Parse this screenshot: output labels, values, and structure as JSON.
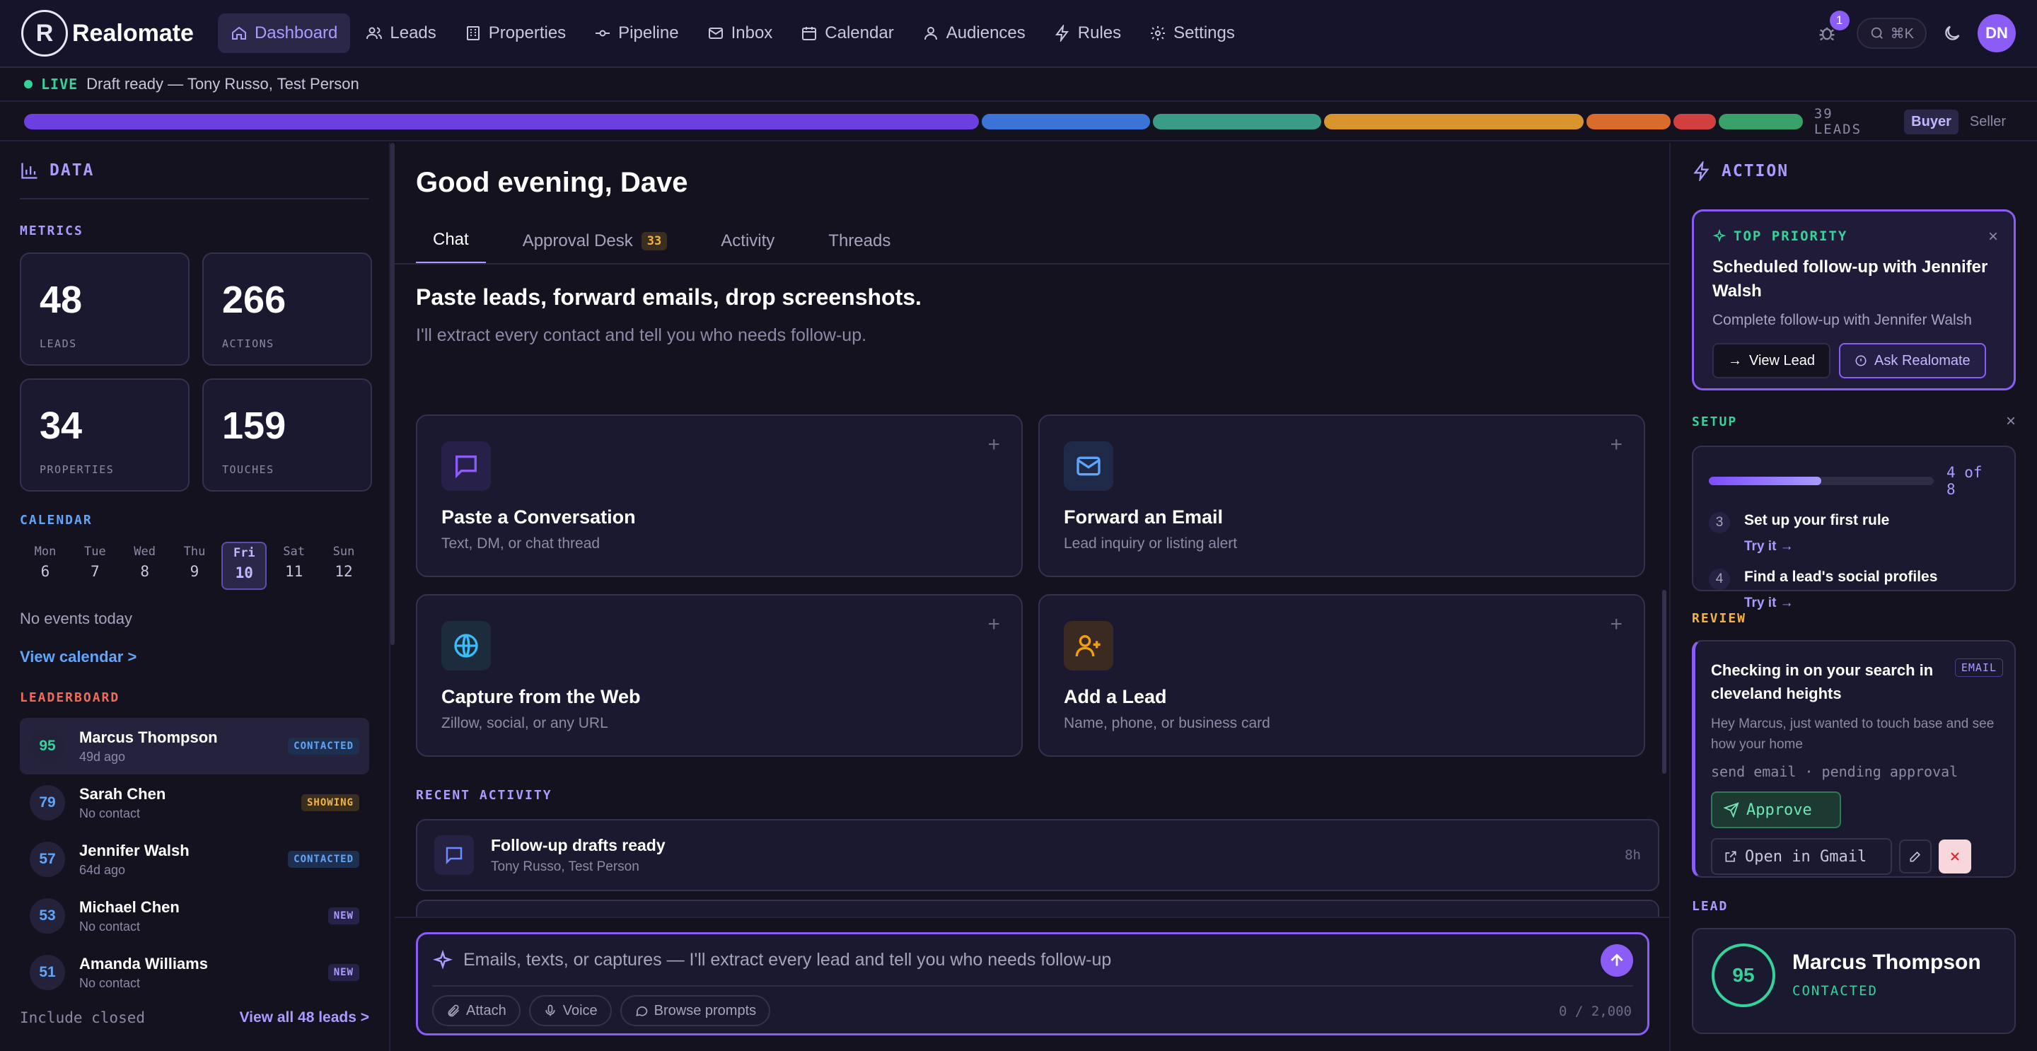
{
  "nav": {
    "brand": "Realomate",
    "brand_initial": "R",
    "items": [
      {
        "label": "Dashboard",
        "icon": "home-icon",
        "active": true
      },
      {
        "label": "Leads",
        "icon": "users-icon"
      },
      {
        "label": "Properties",
        "icon": "building-icon"
      },
      {
        "label": "Pipeline",
        "icon": "commit-icon"
      },
      {
        "label": "Inbox",
        "icon": "mail-icon"
      },
      {
        "label": "Calendar",
        "icon": "calendar-icon"
      },
      {
        "label": "Audiences",
        "icon": "user-circle-icon"
      },
      {
        "label": "Rules",
        "icon": "lightning-icon"
      },
      {
        "label": "Settings",
        "icon": "gear-icon"
      }
    ],
    "bug_count": "1",
    "search_shortcut": "⌘K",
    "avatar_initials": "DN"
  },
  "live": {
    "label": "LIVE",
    "text": "Draft ready — Tony Russo, Test Person"
  },
  "pipeline": {
    "segments": [
      {
        "share": 13.6,
        "color": "#6d3ee0"
      },
      {
        "share": 2.4,
        "color": "#3b74d6"
      },
      {
        "share": 2.4,
        "color": "#3a9c87"
      },
      {
        "share": 3.7,
        "color": "#d8952d"
      },
      {
        "share": 1.2,
        "color": "#d96c2c"
      },
      {
        "share": 0.6,
        "color": "#d13f3f"
      },
      {
        "share": 1.2,
        "color": "#3aa06a"
      }
    ],
    "leads_label": "39 LEADS",
    "toggle": [
      "Buyer",
      "Seller"
    ],
    "toggle_active": "Buyer"
  },
  "left": {
    "header": "DATA",
    "metrics_label": "METRICS",
    "metrics": [
      {
        "value": "48",
        "label": "LEADS"
      },
      {
        "value": "266",
        "label": "ACTIONS"
      },
      {
        "value": "34",
        "label": "PROPERTIES"
      },
      {
        "value": "159",
        "label": "TOUCHES"
      }
    ],
    "calendar_label": "CALENDAR",
    "days": [
      {
        "name": "Mon",
        "date": "6"
      },
      {
        "name": "Tue",
        "date": "7"
      },
      {
        "name": "Wed",
        "date": "8"
      },
      {
        "name": "Thu",
        "date": "9"
      },
      {
        "name": "Fri",
        "date": "10",
        "today": true
      },
      {
        "name": "Sat",
        "date": "11"
      },
      {
        "name": "Sun",
        "date": "12"
      }
    ],
    "no_events": "No events today",
    "view_calendar": "View calendar >",
    "leaderboard_label": "LEADERBOARD",
    "leaders": [
      {
        "score": "95",
        "name": "Marcus Thompson",
        "sub": "49d ago",
        "tag": "CONTACTED",
        "score_color": "#34d399",
        "tag_color": "#60a5fa",
        "tag_bg": "#1e2f4f"
      },
      {
        "score": "79",
        "name": "Sarah Chen",
        "sub": "No contact",
        "tag": "SHOWING",
        "score_color": "#60a5fa",
        "tag_color": "#f5b342",
        "tag_bg": "#3a2f1e"
      },
      {
        "score": "57",
        "name": "Jennifer Walsh",
        "sub": "64d ago",
        "tag": "CONTACTED",
        "score_color": "#60a5fa",
        "tag_color": "#60a5fa",
        "tag_bg": "#1e2f4f"
      },
      {
        "score": "53",
        "name": "Michael Chen",
        "sub": "No contact",
        "tag": "NEW",
        "score_color": "#60a5fa",
        "tag_color": "#a99cff",
        "tag_bg": "#26224a"
      },
      {
        "score": "51",
        "name": "Amanda Williams",
        "sub": "No contact",
        "tag": "NEW",
        "score_color": "#60a5fa",
        "tag_color": "#a99cff",
        "tag_bg": "#26224a"
      }
    ],
    "include_closed": "Include closed",
    "view_all": "View all 48 leads >"
  },
  "center": {
    "greeting": "Good evening, Dave",
    "tabs": [
      {
        "label": "Chat",
        "active": true
      },
      {
        "label": "Approval Desk",
        "count": "33"
      },
      {
        "label": "Activity"
      },
      {
        "label": "Threads"
      }
    ],
    "paste_title": "Paste leads, forward emails, drop screenshots.",
    "paste_sub": "I'll extract every contact and tell you who needs follow-up.",
    "cards": [
      {
        "title": "Paste a Conversation",
        "sub": "Text, DM, or chat thread",
        "icon": "chat-bubble-icon",
        "color": "#8b5cf6",
        "bg": "#27214a"
      },
      {
        "title": "Forward an Email",
        "sub": "Lead inquiry or listing alert",
        "icon": "envelope-icon",
        "color": "#60a5fa",
        "bg": "#1f2a48"
      },
      {
        "title": "Capture from the Web",
        "sub": "Zillow, social, or any URL",
        "icon": "globe-icon",
        "color": "#38bdf8",
        "bg": "#1d2c3d"
      },
      {
        "title": "Add a Lead",
        "sub": "Name, phone, or business card",
        "icon": "user-plus-icon",
        "color": "#f59e0b",
        "bg": "#3a2a22"
      }
    ],
    "plus": "+",
    "recent_label": "RECENT ACTIVITY",
    "activity": [
      {
        "title": "Follow-up drafts ready",
        "sub": "Tony Russo, Test Person",
        "time": "8h"
      }
    ],
    "composer": {
      "placeholder": "Emails, texts, or captures — I'll extract every lead and tell you who needs follow-up",
      "pills": [
        "Attach",
        "Voice",
        "Browse prompts"
      ],
      "counter": "0 / 2,000"
    }
  },
  "right": {
    "header": "ACTION",
    "priority": {
      "label": "TOP PRIORITY",
      "title": "Scheduled follow-up with Jennifer Walsh",
      "sub": "Complete follow-up with Jennifer Walsh",
      "view": "View Lead",
      "ask": "Ask Realomate"
    },
    "setup": {
      "label": "SETUP",
      "progress": 0.5,
      "count": "4 of 8",
      "steps": [
        {
          "num": "3",
          "title": "Set up your first rule",
          "try": "Try it →"
        },
        {
          "num": "4",
          "title": "Find a lead's social profiles",
          "try": "Try it →"
        }
      ]
    },
    "review": {
      "label": "REVIEW",
      "title": "Checking in on your search in cleveland heights",
      "tag": "EMAIL",
      "body": "Hey Marcus, just wanted to touch base and see how your home",
      "meta": "send email · pending approval",
      "approve": "Approve",
      "gmail": "Open in Gmail"
    },
    "lead": {
      "label": "LEAD",
      "score": "95",
      "name": "Marcus Thompson",
      "status": "CONTACTED"
    }
  },
  "colors": {
    "accent": "#8b5cf6",
    "bg": "#14121f",
    "panel": "#1b1930",
    "green": "#34d399",
    "amber": "#f5b342",
    "red": "#ef6c5a"
  }
}
